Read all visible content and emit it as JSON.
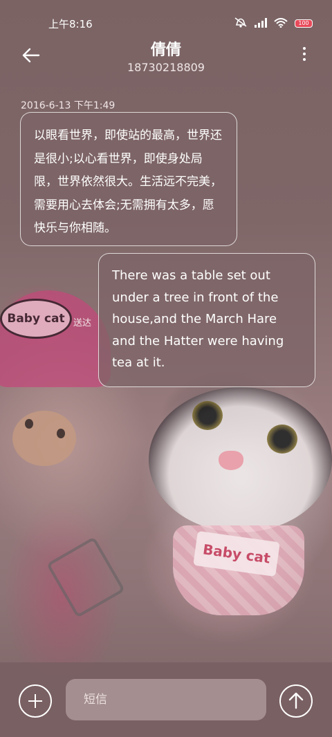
{
  "status_bar": {
    "time": "上午8:16",
    "battery": "100",
    "icons": [
      "mute-icon",
      "signal-icon",
      "wifi-icon",
      "battery-icon"
    ]
  },
  "header": {
    "contact_name": "倩倩",
    "phone_number": "18730218809"
  },
  "conversation": {
    "timestamp": "2016-6-13 下午1:49",
    "messages": [
      {
        "direction": "incoming",
        "text": "以眼看世界，即使站的最高，世界还是很小;以心看世界，即使身处局限，世界依然很大。生活远不完美，需要用心去体会;无需拥有太多，愿快乐与你相随。"
      },
      {
        "direction": "outgoing",
        "text": "There was a table set out under a tree in front of the house,and the March Hare and the Hatter were having tea at it.",
        "status": "送达"
      }
    ]
  },
  "wallpaper": {
    "cap_text": "Baby cat",
    "bib_text": "Baby cat"
  },
  "composer": {
    "placeholder": "短信"
  },
  "colors": {
    "accent_battery": "#e84a5a",
    "bubble_fill": "#7d6466",
    "background": "#8a6e6f"
  }
}
